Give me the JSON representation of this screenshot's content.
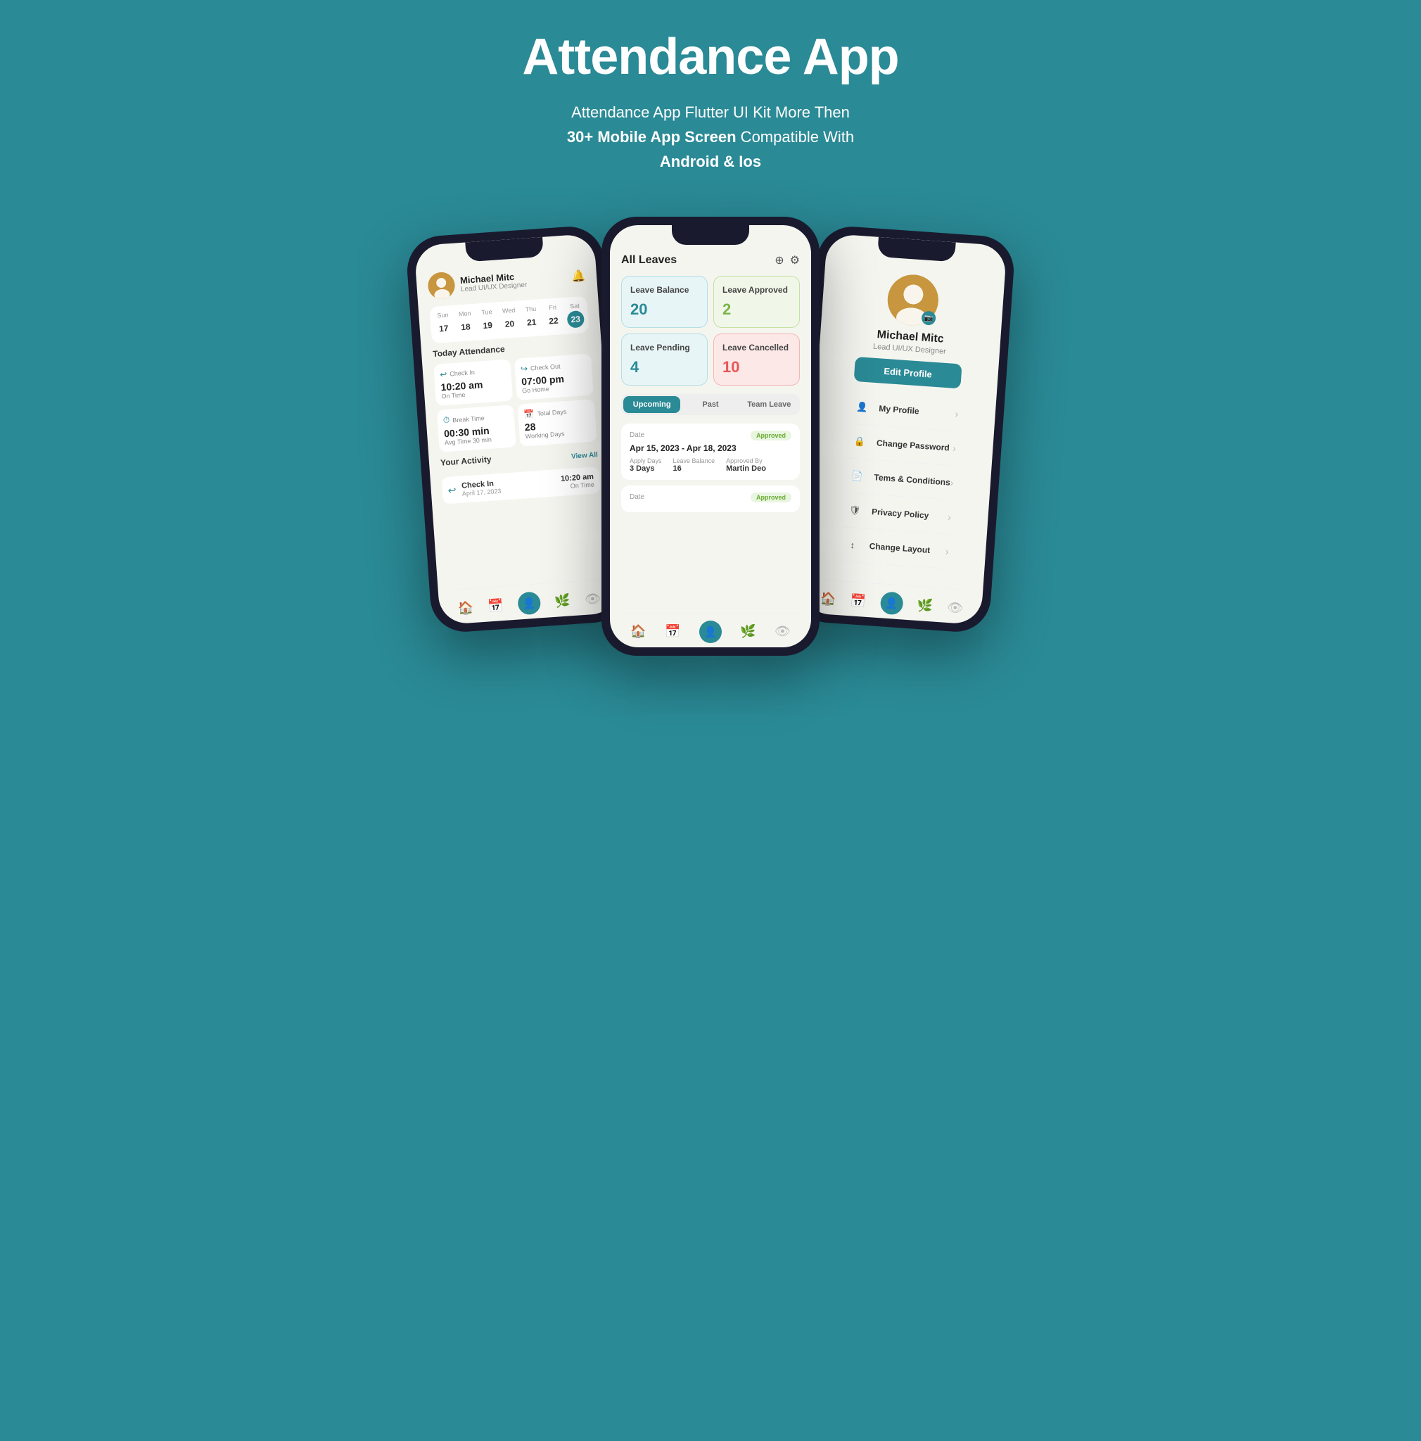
{
  "page": {
    "title": "Attendance App",
    "subtitle_line1": "Attendance App Flutter UI Kit More Then",
    "subtitle_line2": "30+ Mobile App Screen",
    "subtitle_line3": " Compatible With",
    "subtitle_line4": "Android & Ios",
    "bg_color": "#2a8a96"
  },
  "phone_left": {
    "user": {
      "name": "Michael Mitc",
      "role": "Lead UI/UX Designer"
    },
    "calendar": {
      "days": [
        "Sun",
        "Mon",
        "Tue",
        "Wed",
        "Thu",
        "Fri",
        "Sat"
      ],
      "dates": [
        "17",
        "18",
        "19",
        "20",
        "21",
        "22",
        "23"
      ],
      "active_index": 6
    },
    "today_attendance_label": "Today Attendance",
    "cards": [
      {
        "label": "Check In",
        "icon": "↩",
        "time": "10:20 am",
        "status": "On Time"
      },
      {
        "label": "Check Out",
        "icon": "↪",
        "time": "07:00 pm",
        "status": "Go Home"
      },
      {
        "label": "Break Time",
        "icon": "☕",
        "time": "00:30 min",
        "status": "Avg Time 30 min"
      },
      {
        "label": "Total Days",
        "icon": "📅",
        "time": "28",
        "status": "Working Days"
      }
    ],
    "activity_label": "Your Activity",
    "view_all": "View All",
    "activity": {
      "icon": "↩",
      "title": "Check In",
      "date": "April 17, 2023",
      "time": "10:20 am",
      "status": "On Time"
    },
    "nav": [
      "🏠",
      "📅",
      "👤",
      "🌿",
      "👁"
    ]
  },
  "phone_center": {
    "title": "All Leaves",
    "add_icon": "⊕",
    "filter_icon": "⚙",
    "cards": [
      {
        "label": "Leave Balance",
        "value": "20",
        "type": "balance"
      },
      {
        "label": "Leave Approved",
        "value": "2",
        "type": "approved"
      },
      {
        "label": "Leave Pending",
        "value": "4",
        "type": "pending"
      },
      {
        "label": "Leave Cancelled",
        "value": "10",
        "type": "cancelled"
      }
    ],
    "tabs": [
      "Upcoming",
      "Past",
      "Team Leave"
    ],
    "active_tab": 0,
    "leaves": [
      {
        "date_label": "Date",
        "status": "Approved",
        "dates": "Apr 15, 2023 - Apr 18, 2023",
        "apply_days_label": "Apply Days",
        "apply_days": "3 Days",
        "leave_balance_label": "Leave Balance",
        "leave_balance": "16",
        "approved_by_label": "Approved By",
        "approved_by": "Martin Deo"
      },
      {
        "date_label": "Date",
        "status": "Approved",
        "dates": "",
        "apply_days_label": "",
        "apply_days": "",
        "leave_balance_label": "",
        "leave_balance": "",
        "approved_by_label": "",
        "approved_by": ""
      }
    ],
    "nav": [
      "🏠",
      "📅",
      "👤",
      "🌿",
      "👁"
    ]
  },
  "phone_right": {
    "user": {
      "name": "Michael Mitc",
      "role": "Lead UI/UX Designer"
    },
    "edit_profile_btn": "Edit Profile",
    "menu_items": [
      {
        "icon": "👤",
        "label": "My Profile"
      },
      {
        "icon": "🔒",
        "label": "Change Password"
      },
      {
        "icon": "📄",
        "label": "Tems & Conditions"
      },
      {
        "icon": "🛡",
        "label": "Privacy Policy"
      },
      {
        "icon": "↕",
        "label": "Change Layout"
      }
    ],
    "nav": [
      "🏠",
      "📅",
      "👤",
      "🌿",
      "👁"
    ]
  }
}
